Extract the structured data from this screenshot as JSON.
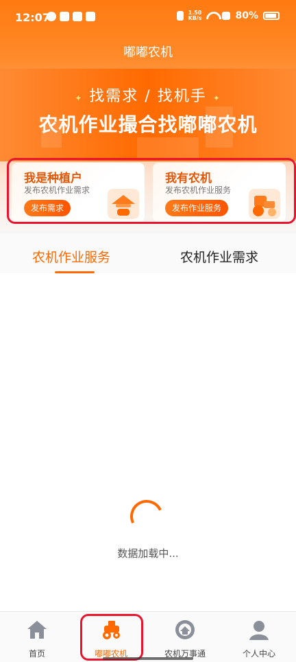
{
  "status_bar": {
    "time": "12:07",
    "net_speed_value": "1.50",
    "net_speed_unit": "KB/s",
    "battery": "80%"
  },
  "app": {
    "title": "嘟嘟农机"
  },
  "banner": {
    "subtitle": "找需求 / 找机手",
    "headline": "农机作业撮合找嘟嘟农机"
  },
  "cards": [
    {
      "title": "我是种植户",
      "desc": "发布农机作业需求",
      "button": "发布需求",
      "icon": "farmer-hat-icon"
    },
    {
      "title": "我有农机",
      "desc": "发布农机作业服务",
      "button": "发布作业服务",
      "icon": "tractor-icon"
    }
  ],
  "tabs": [
    {
      "label": "农机作业服务",
      "active": true
    },
    {
      "label": "农机作业需求",
      "active": false
    }
  ],
  "loading": {
    "text": "数据加载中..."
  },
  "nav": [
    {
      "label": "首页",
      "icon": "home-icon"
    },
    {
      "label": "嘟嘟农机",
      "icon": "tractor-icon",
      "active": true
    },
    {
      "label": "农机万事通",
      "icon": "service-icon"
    },
    {
      "label": "个人中心",
      "icon": "person-icon"
    }
  ],
  "colors": {
    "brand": "#ff6a00",
    "highlight": "#e8132c"
  }
}
